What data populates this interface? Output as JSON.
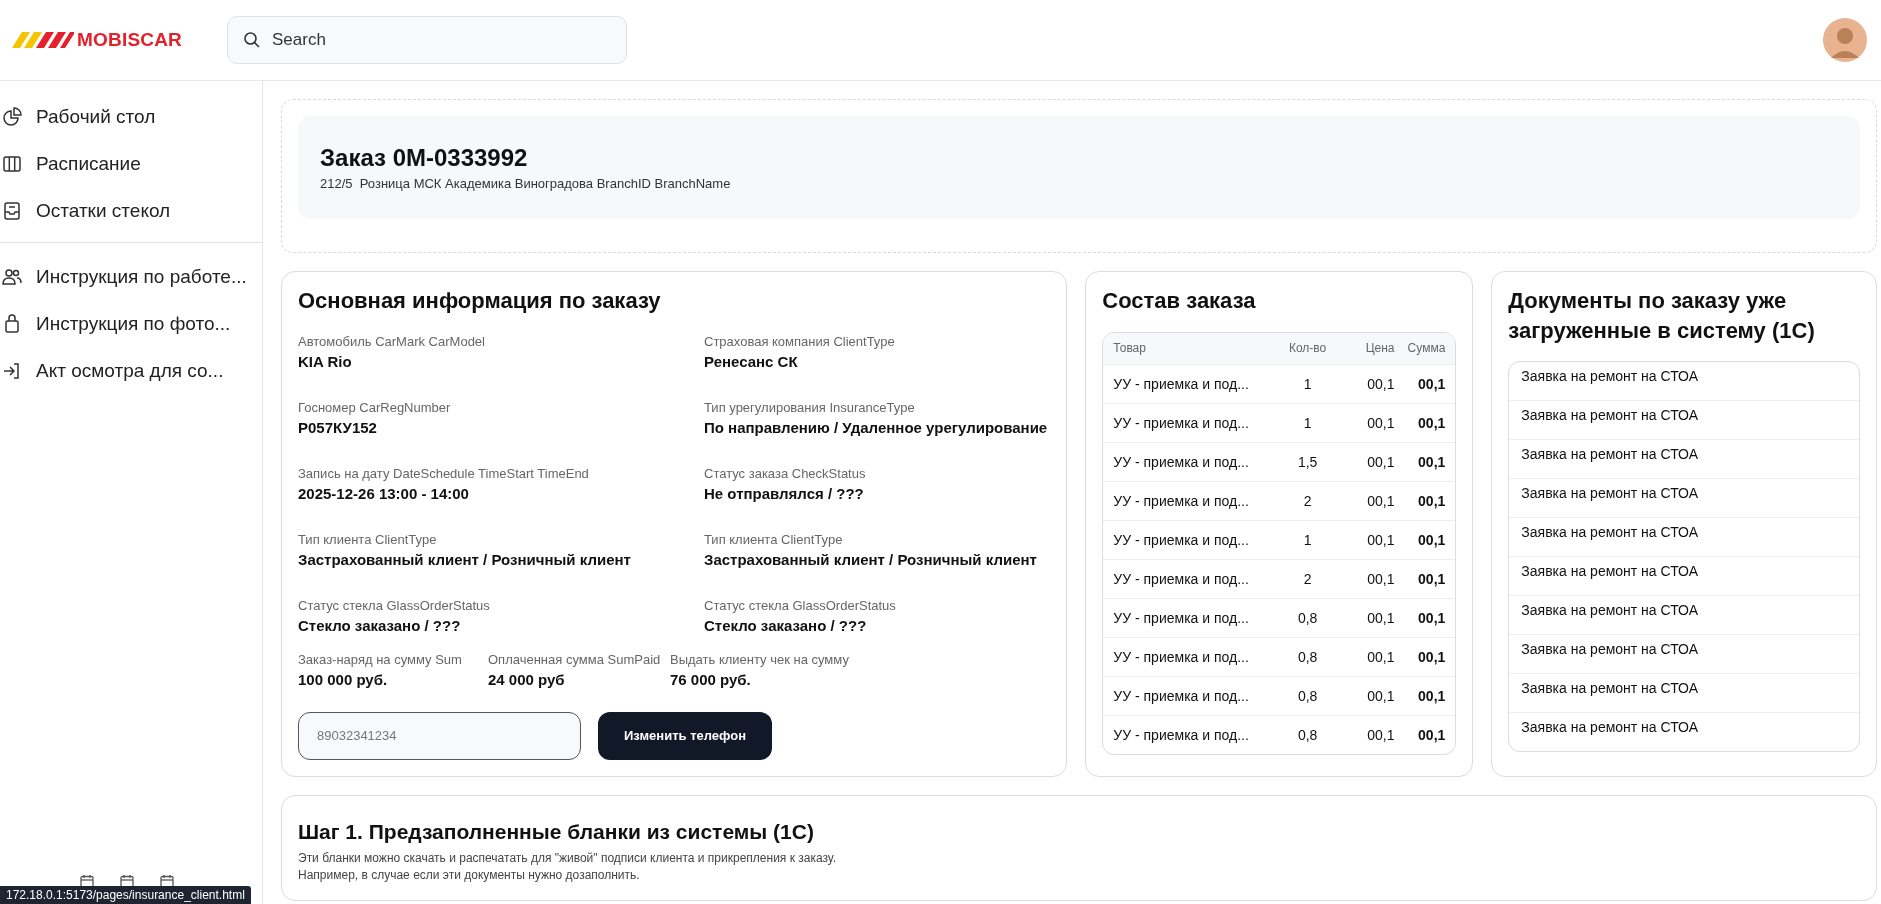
{
  "header": {
    "logo": "MOBISCAR",
    "search": {
      "placeholder": "Search"
    }
  },
  "sidebar": {
    "groups": [
      [
        {
          "label": "Рабочий стол"
        },
        {
          "label": "Расписание"
        },
        {
          "label": "Остатки стекол"
        }
      ],
      [
        {
          "label": "Инструкция по работе..."
        },
        {
          "label": "Инструкция по фото..."
        },
        {
          "label": "Акт осмотра для со..."
        }
      ]
    ]
  },
  "order": {
    "title": "Заказ 0M-0333992",
    "subtitle": "212/5  Розница МСК Академика Виноградова BranchID BranchName"
  },
  "info": {
    "title": "Основная информация по заказу",
    "fields": [
      {
        "label": "Автомобиль CarMark CarModel",
        "value": "KIA Rio"
      },
      {
        "label": "Страховая компания ClientType",
        "value": "Ренесанс СК"
      },
      {
        "label": "Госномер CarRegNumber",
        "value": "Р057КУ152"
      },
      {
        "label": "Тип урегулирования InsuranceType",
        "value": "По направлению / Удаленное урегулирование"
      },
      {
        "label": "Запись на дату DateSchedule TimeStart TimeEnd",
        "value": "2025-12-26 13:00 - 14:00"
      },
      {
        "label": "Статус заказа CheckStatus",
        "value": "Не отправлялся / ???"
      },
      {
        "label": "Тип клиента ClientType",
        "value": "Застрахованный клиент / Розничный клиент"
      },
      {
        "label": "Тип клиента ClientType",
        "value": "Застрахованный клиент / Розничный клиент"
      },
      {
        "label": "Статус стекла GlassOrderStatus",
        "value": "Стекло заказано / ???"
      },
      {
        "label": "Статус стекла GlassOrderStatus",
        "value": "Стекло заказано / ???"
      }
    ],
    "sums": [
      {
        "label": "Заказ-наряд на сумму Sum",
        "value": "100 000 руб."
      },
      {
        "label": "Оплаченная сумма SumPaid",
        "value": "24 000 руб"
      },
      {
        "label": "Выдать клиенту чек на сумму",
        "value": "76 000 руб."
      }
    ],
    "phone": {
      "placeholder": "89032341234"
    },
    "button": "Изменить телефон"
  },
  "composition": {
    "title": "Состав заказа",
    "columns": [
      "Товар",
      "Кол-во",
      "Цена",
      "Сумма"
    ],
    "rows": [
      {
        "name": "УУ - приемка и под...",
        "qty": "1",
        "price": "00,1",
        "sum": "00,1"
      },
      {
        "name": "УУ - приемка и под...",
        "qty": "1",
        "price": "00,1",
        "sum": "00,1"
      },
      {
        "name": "УУ - приемка и под...",
        "qty": "1,5",
        "price": "00,1",
        "sum": "00,1"
      },
      {
        "name": "УУ - приемка и под...",
        "qty": "2",
        "price": "00,1",
        "sum": "00,1"
      },
      {
        "name": "УУ - приемка и под...",
        "qty": "1",
        "price": "00,1",
        "sum": "00,1"
      },
      {
        "name": "УУ - приемка и под...",
        "qty": "2",
        "price": "00,1",
        "sum": "00,1"
      },
      {
        "name": "УУ - приемка и под...",
        "qty": "0,8",
        "price": "00,1",
        "sum": "00,1"
      },
      {
        "name": "УУ - приемка и под...",
        "qty": "0,8",
        "price": "00,1",
        "sum": "00,1"
      },
      {
        "name": "УУ - приемка и под...",
        "qty": "0,8",
        "price": "00,1",
        "sum": "00,1"
      },
      {
        "name": "УУ - приемка и под...",
        "qty": "0,8",
        "price": "00,1",
        "sum": "00,1"
      }
    ]
  },
  "documents": {
    "title": "Документы по заказу уже загруженные в систему (1С)",
    "items": [
      "Заявка на ремонт на СТОА",
      "Заявка на ремонт на СТОА",
      "Заявка на ремонт на СТОА",
      "Заявка на ремонт на СТОА",
      "Заявка на ремонт на СТОА",
      "Заявка на ремонт на СТОА",
      "Заявка на ремонт на СТОА",
      "Заявка на ремонт на СТОА",
      "Заявка на ремонт на СТОА",
      "Заявка на ремонт на СТОА"
    ]
  },
  "step": {
    "title": "Шаг 1. Предзаполненные бланки из системы (1С)",
    "lines": [
      "Эти бланки можно скачать и распечатать для \"живой\" подписи клиента и прикрепления к заказу.",
      "Например, в случае если эти документы нужно дозаполнить."
    ]
  },
  "status_bar": {
    "url": "172.18.0.1:5173/pages/insurance_client.html"
  }
}
